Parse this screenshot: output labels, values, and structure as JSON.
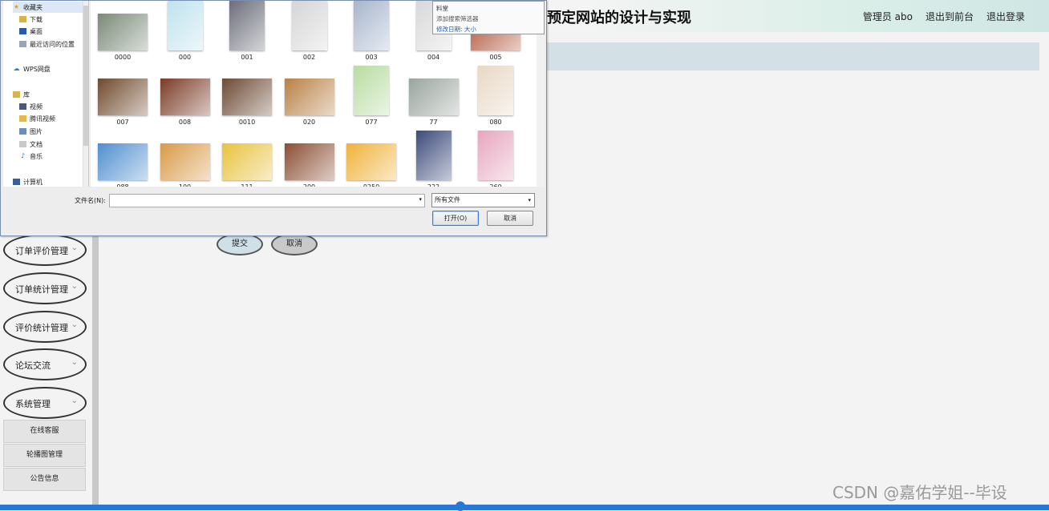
{
  "page": {
    "title": "预定网站的设计与实现",
    "user_label": "管理员 abo",
    "links": [
      "退出到前台",
      "退出登录"
    ]
  },
  "sidebar": {
    "menus": [
      {
        "label": "订单评价管理"
      },
      {
        "label": "订单统计管理"
      },
      {
        "label": "评价统计管理"
      },
      {
        "label": "论坛交流"
      },
      {
        "label": "系统管理"
      }
    ],
    "chevron": "⌄",
    "subitems": [
      {
        "label": "在线客服"
      },
      {
        "label": "轮播图管理"
      },
      {
        "label": "公告信息"
      }
    ]
  },
  "form": {
    "submit": "提交",
    "cancel": "取消"
  },
  "dialog": {
    "nav": [
      {
        "label": "收藏夹",
        "icon": "star-icon"
      },
      {
        "label": "下载",
        "icon": "download-folder-icon"
      },
      {
        "label": "桌面",
        "icon": "desktop-icon"
      },
      {
        "label": "最近访问的位置",
        "icon": "recent-icon"
      },
      {
        "label": "WPS网盘",
        "icon": "cloud-icon"
      },
      {
        "label": "库",
        "icon": "library-icon"
      },
      {
        "label": "视频",
        "icon": "video-icon"
      },
      {
        "label": "腾讯视频",
        "icon": "folder-icon"
      },
      {
        "label": "图片",
        "icon": "picture-icon"
      },
      {
        "label": "文档",
        "icon": "document-icon"
      },
      {
        "label": "音乐",
        "icon": "music-icon"
      },
      {
        "label": "计算机",
        "icon": "computer-icon"
      }
    ],
    "files": [
      {
        "name": "0000",
        "color": "#7a8a78"
      },
      {
        "name": "000",
        "color": "#bfe2ee"
      },
      {
        "name": "001",
        "color": "#6b6e7a"
      },
      {
        "name": "002",
        "color": "#d5d5d5"
      },
      {
        "name": "003",
        "color": "#a7b6cc"
      },
      {
        "name": "004",
        "color": "#d8d8d8"
      },
      {
        "name": "005",
        "color": "#b0543a"
      },
      {
        "name": "007",
        "color": "#6f4a2d"
      },
      {
        "name": "008",
        "color": "#7a3b26"
      },
      {
        "name": "0010",
        "color": "#6d4a34"
      },
      {
        "name": "020",
        "color": "#b98145"
      },
      {
        "name": "077",
        "color": "#b7dca0"
      },
      {
        "name": "77",
        "color": "#9aa59e"
      },
      {
        "name": "080",
        "color": "#e8d8c4"
      },
      {
        "name": "088",
        "color": "#4f8fcf"
      },
      {
        "name": "100",
        "color": "#d99a47"
      },
      {
        "name": "111",
        "color": "#e8c23e"
      },
      {
        "name": "200",
        "color": "#8a4f34"
      },
      {
        "name": "0250",
        "color": "#f0b23a"
      },
      {
        "name": "222",
        "color": "#3b4a7a"
      },
      {
        "name": "260",
        "color": "#e7a6be"
      }
    ],
    "tooltip": {
      "line1": "料堂",
      "line2": "添加搜索筛选器",
      "line3": "修改日期:    大小"
    },
    "filename_label": "文件名(N):",
    "filename_value": "",
    "filetype": "所有文件",
    "open_button": "打开(O)",
    "cancel_button": "取消"
  },
  "watermark": "CSDN @嘉佑学姐--毕设"
}
